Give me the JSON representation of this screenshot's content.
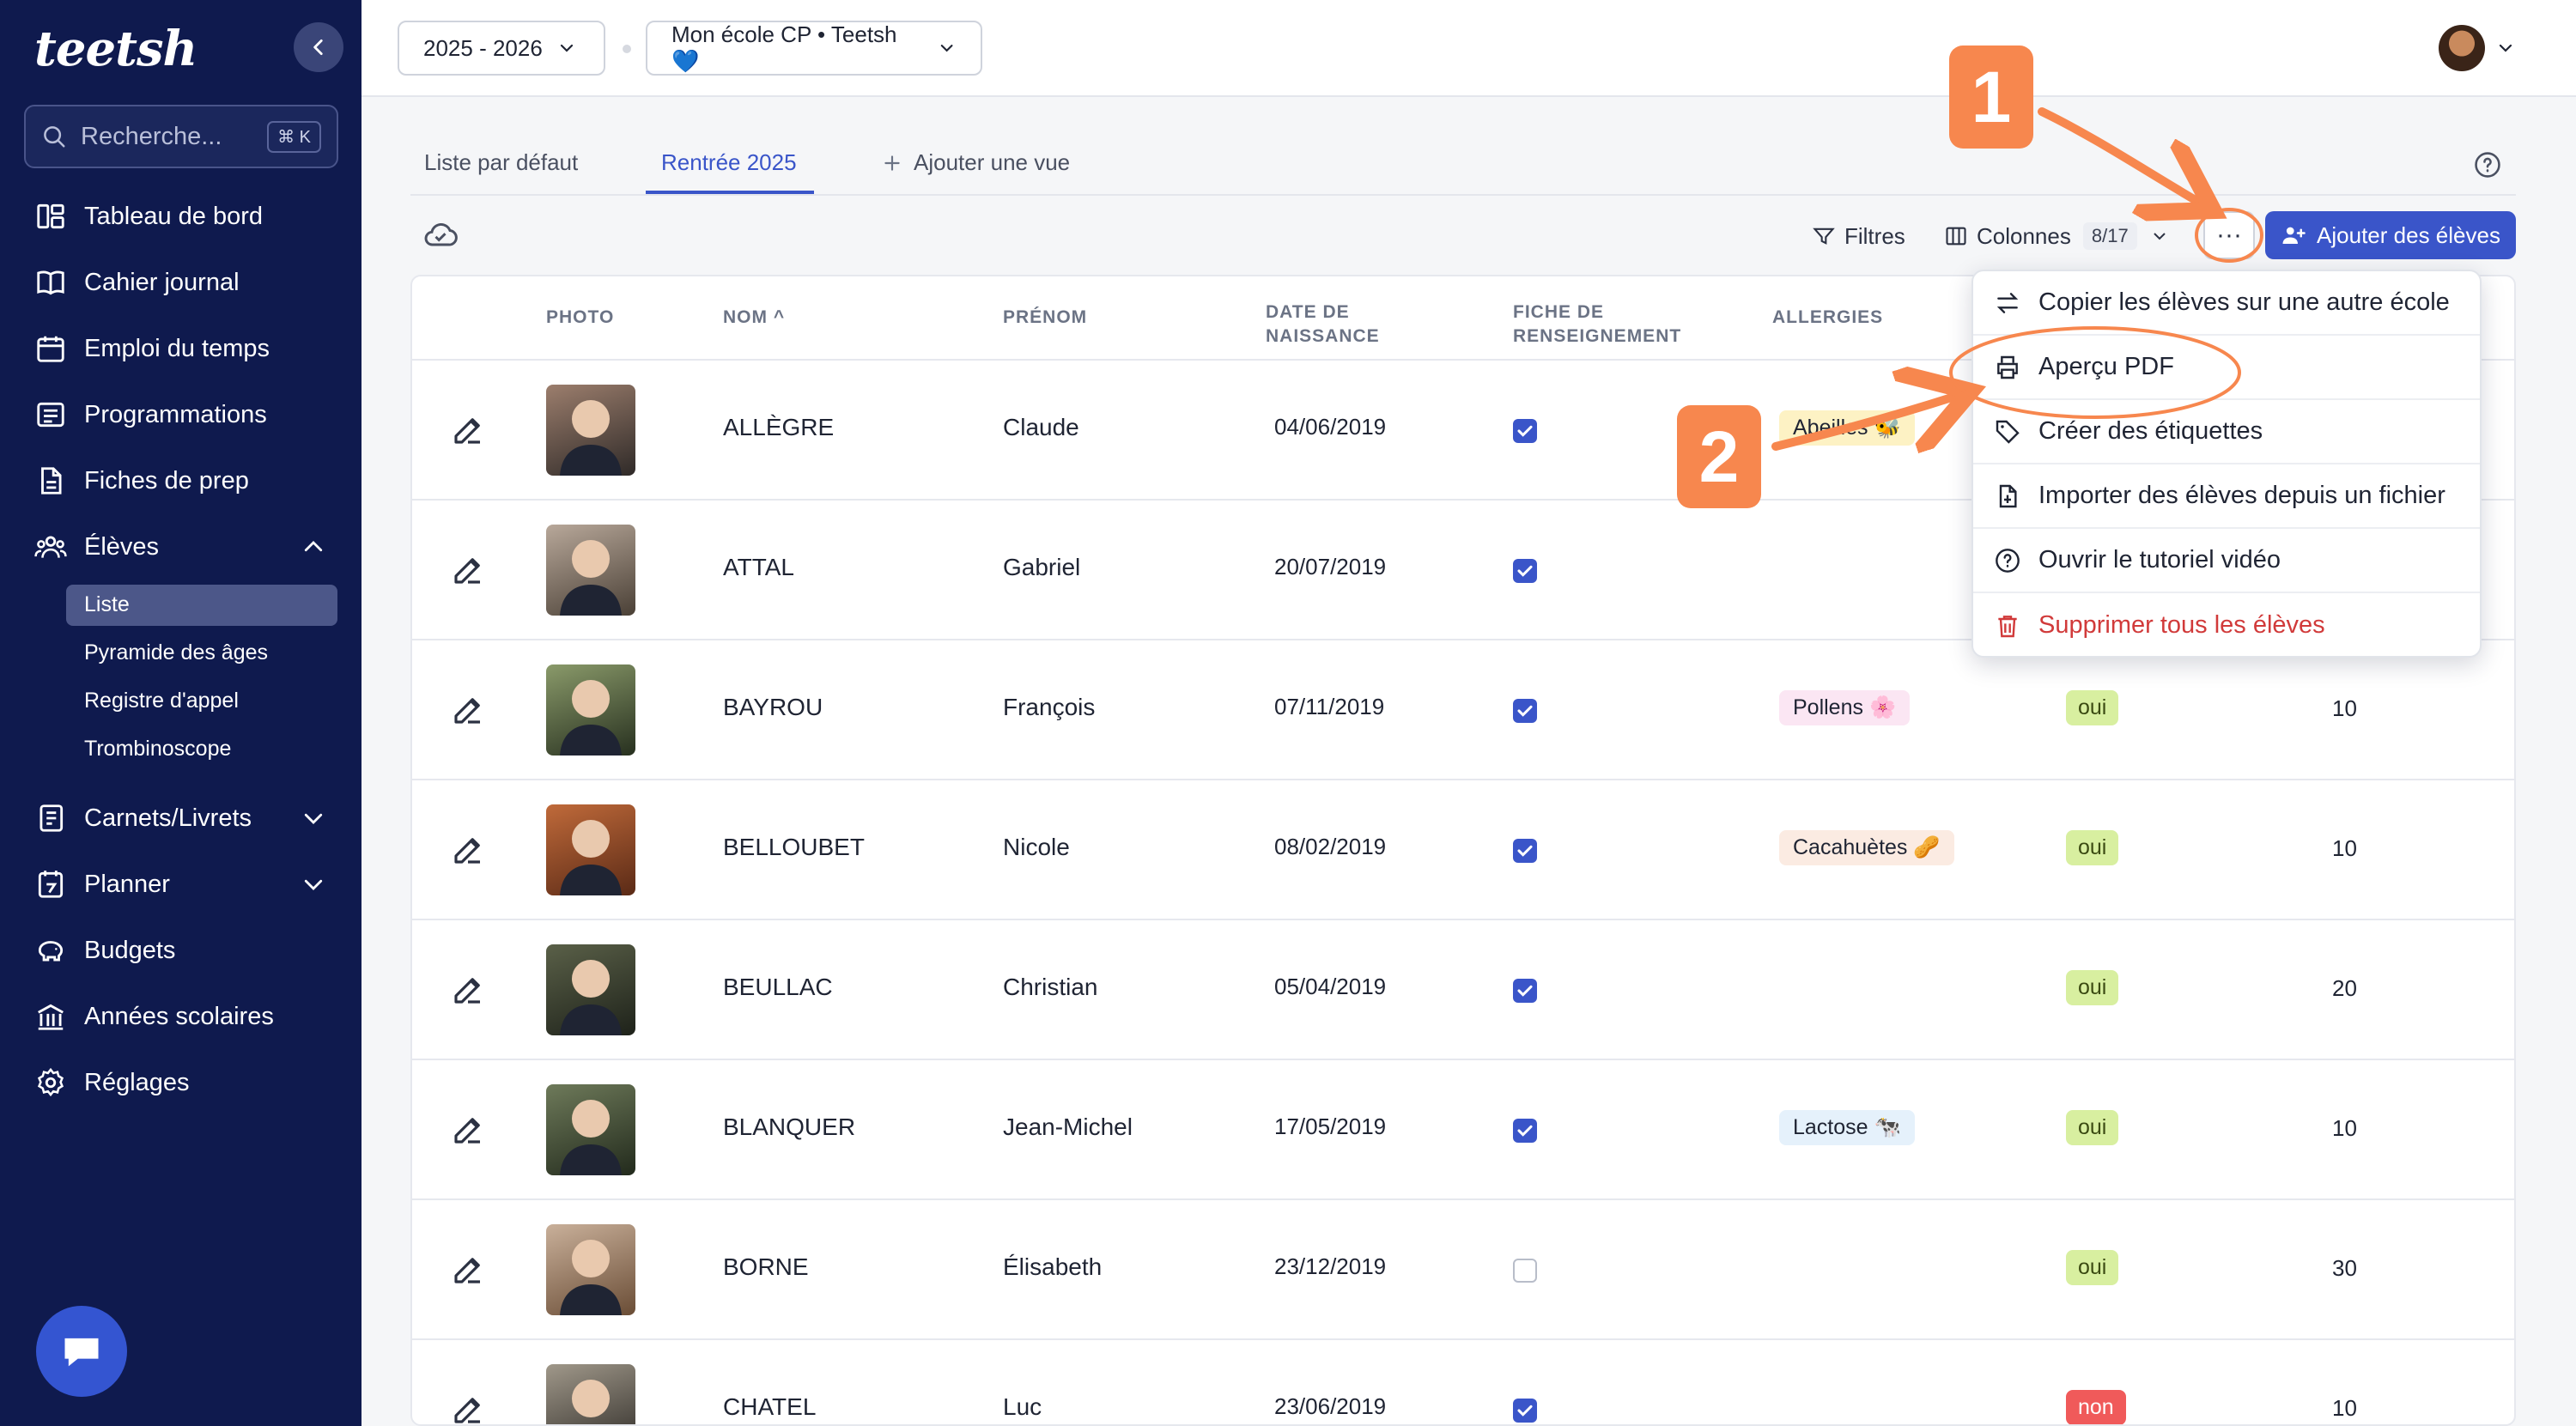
{
  "colors": {
    "sidebar": "#0f1a4e",
    "accent": "#3a55c9",
    "annotation": "#f7874e",
    "danger": "#d13a3a"
  },
  "sidebar": {
    "logo": "teetsh",
    "search_placeholder": "Recherche...",
    "search_shortcut": "⌘ K",
    "items": [
      {
        "label": "Tableau de bord",
        "icon": "dashboard-icon"
      },
      {
        "label": "Cahier journal",
        "icon": "book-icon"
      },
      {
        "label": "Emploi du temps",
        "icon": "calendar-icon"
      },
      {
        "label": "Programmations",
        "icon": "list-icon"
      },
      {
        "label": "Fiches de prep",
        "icon": "document-icon"
      },
      {
        "label": "Élèves",
        "icon": "users-icon"
      },
      {
        "label": "Carnets/Livrets",
        "icon": "notebook-icon"
      },
      {
        "label": "Planner",
        "icon": "planner-icon"
      },
      {
        "label": "Budgets",
        "icon": "piggy-bank-icon"
      },
      {
        "label": "Années scolaires",
        "icon": "school-icon"
      },
      {
        "label": "Réglages",
        "icon": "gear-icon"
      }
    ],
    "subitems": [
      "Liste",
      "Pyramide des âges",
      "Registre d'appel",
      "Trombinoscope"
    ]
  },
  "header": {
    "year_select": "2025 - 2026",
    "school_select": "Mon école CP • Teetsh 💙"
  },
  "tabs": [
    "Liste par défaut",
    "Rentrée 2025",
    "Ajouter une vue"
  ],
  "toolbar": {
    "filters": "Filtres",
    "columns": "Colonnes",
    "columns_count": "8/17",
    "more": "···",
    "add_students": "Ajouter des élèves"
  },
  "table": {
    "columns": [
      "PHOTO",
      "NOM ^",
      "PRÉNOM",
      "DATE DE NAISSANCE",
      "FICHE DE RENSEIGNEMENT",
      "ALLERGIES"
    ],
    "rows": [
      {
        "nom": "ALLÈGRE",
        "prenom": "Claude",
        "date": "04/06/2019",
        "fiche": true,
        "allergie": "Abeilles 🐝",
        "allergie_color": "#fdf2c4",
        "oui": "",
        "num": ""
      },
      {
        "nom": "ATTAL",
        "prenom": "Gabriel",
        "date": "20/07/2019",
        "fiche": true,
        "allergie": "",
        "allergie_color": "",
        "oui": "",
        "num": ""
      },
      {
        "nom": "BAYROU",
        "prenom": "François",
        "date": "07/11/2019",
        "fiche": true,
        "allergie": "Pollens 🌸",
        "allergie_color": "#fbe6f3",
        "oui": "oui",
        "num": "10"
      },
      {
        "nom": "BELLOUBET",
        "prenom": "Nicole",
        "date": "08/02/2019",
        "fiche": true,
        "allergie": "Cacahuètes 🥜",
        "allergie_color": "#fbebe2",
        "oui": "oui",
        "num": "10"
      },
      {
        "nom": "BEULLAC",
        "prenom": "Christian",
        "date": "05/04/2019",
        "fiche": true,
        "allergie": "",
        "allergie_color": "",
        "oui": "oui",
        "num": "20"
      },
      {
        "nom": "BLANQUER",
        "prenom": "Jean-Michel",
        "date": "17/05/2019",
        "fiche": true,
        "allergie": "Lactose 🐄",
        "allergie_color": "#e5f1fb",
        "oui": "oui",
        "num": "10"
      },
      {
        "nom": "BORNE",
        "prenom": "Élisabeth",
        "date": "23/12/2019",
        "fiche": false,
        "allergie": "",
        "allergie_color": "",
        "oui": "oui",
        "num": "30"
      },
      {
        "nom": "CHATEL",
        "prenom": "Luc",
        "date": "23/06/2019",
        "fiche": true,
        "allergie": "",
        "allergie_color": "",
        "oui": "non",
        "num": "10"
      }
    ]
  },
  "menu": {
    "items": [
      {
        "label": "Copier les élèves sur une autre école",
        "icon": "swap-icon"
      },
      {
        "label": "Aperçu PDF",
        "icon": "printer-icon"
      },
      {
        "label": "Créer des étiquettes",
        "icon": "tag-icon"
      },
      {
        "label": "Importer des élèves depuis un fichier",
        "icon": "file-import-icon"
      },
      {
        "label": "Ouvrir le tutoriel vidéo",
        "icon": "help-circle-icon"
      },
      {
        "label": "Supprimer tous les élèves",
        "icon": "trash-icon"
      }
    ]
  },
  "annotations": {
    "step1": "1",
    "step2": "2"
  }
}
